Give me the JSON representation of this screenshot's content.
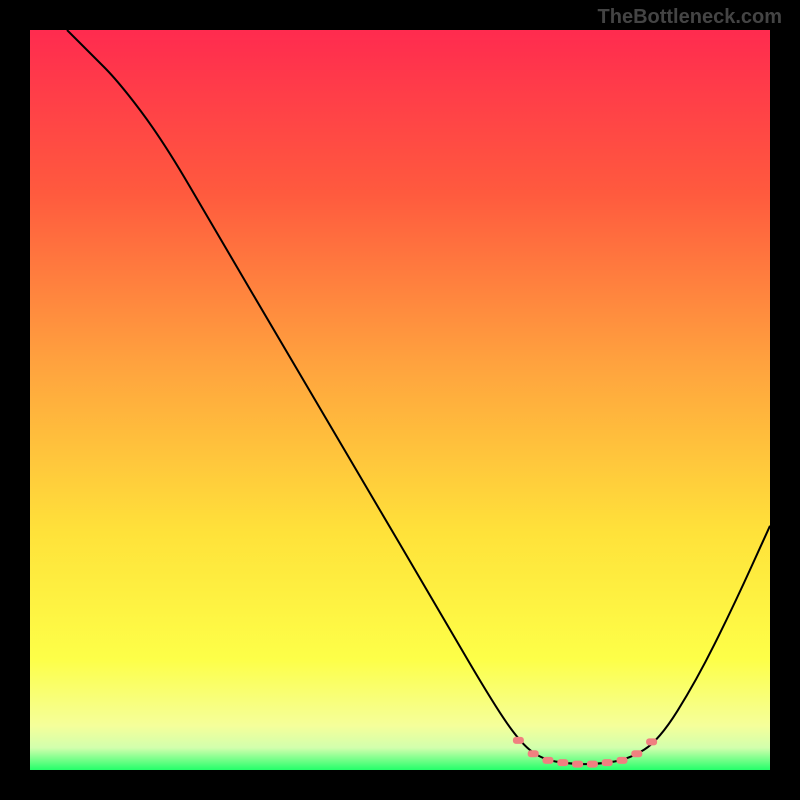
{
  "attribution": "TheBottleneck.com",
  "chart_data": {
    "type": "line",
    "title": "",
    "xlabel": "",
    "ylabel": "",
    "xlim": [
      0,
      100
    ],
    "ylim": [
      0,
      100
    ],
    "grid": false,
    "gradient_stops": [
      {
        "offset": 0,
        "color": "#ff2b4f"
      },
      {
        "offset": 22,
        "color": "#ff5a3e"
      },
      {
        "offset": 45,
        "color": "#ffa23e"
      },
      {
        "offset": 68,
        "color": "#ffe23a"
      },
      {
        "offset": 85,
        "color": "#fdff48"
      },
      {
        "offset": 94,
        "color": "#f5ff9a"
      },
      {
        "offset": 97,
        "color": "#d2ffad"
      },
      {
        "offset": 100,
        "color": "#25ff6a"
      }
    ],
    "curve": [
      {
        "x": 5,
        "y": 100
      },
      {
        "x": 8,
        "y": 97
      },
      {
        "x": 12,
        "y": 93
      },
      {
        "x": 18,
        "y": 85
      },
      {
        "x": 25,
        "y": 73
      },
      {
        "x": 35,
        "y": 56
      },
      {
        "x": 45,
        "y": 39
      },
      {
        "x": 55,
        "y": 22
      },
      {
        "x": 62,
        "y": 10
      },
      {
        "x": 66,
        "y": 4
      },
      {
        "x": 69,
        "y": 1.5
      },
      {
        "x": 73,
        "y": 0.8
      },
      {
        "x": 77,
        "y": 0.8
      },
      {
        "x": 81,
        "y": 1.5
      },
      {
        "x": 85,
        "y": 4
      },
      {
        "x": 90,
        "y": 12
      },
      {
        "x": 95,
        "y": 22
      },
      {
        "x": 100,
        "y": 33
      }
    ],
    "markers": [
      {
        "x": 66,
        "y": 4
      },
      {
        "x": 68,
        "y": 2.2
      },
      {
        "x": 70,
        "y": 1.3
      },
      {
        "x": 72,
        "y": 1.0
      },
      {
        "x": 74,
        "y": 0.8
      },
      {
        "x": 76,
        "y": 0.8
      },
      {
        "x": 78,
        "y": 1.0
      },
      {
        "x": 80,
        "y": 1.3
      },
      {
        "x": 82,
        "y": 2.2
      },
      {
        "x": 84,
        "y": 3.8
      }
    ],
    "marker_color": "#f08080"
  }
}
